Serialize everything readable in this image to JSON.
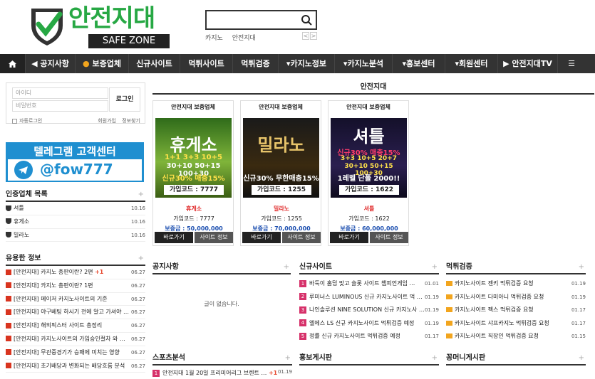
{
  "header": {
    "logo_ko": "안전지대",
    "logo_en": "SAFE ZONE",
    "search_placeholder": "",
    "keywords": [
      "카지노",
      "안전지대"
    ],
    "arrow_prev": "<",
    "arrow_next": ">"
  },
  "nav": [
    {
      "label": "공지사항",
      "icon": "megaphone-icon"
    },
    {
      "label": "보증업체",
      "icon": "medal-icon"
    },
    {
      "label": "신규사이트",
      "icon": ""
    },
    {
      "label": "먹튀사이트",
      "icon": ""
    },
    {
      "label": "먹튀검증",
      "icon": ""
    },
    {
      "label": "카지노정보",
      "icon": "caret-down-icon"
    },
    {
      "label": "카지노분석",
      "icon": "caret-down-icon"
    },
    {
      "label": "홍보센터",
      "icon": "caret-down-icon"
    },
    {
      "label": "회원센터",
      "icon": "caret-down-icon"
    },
    {
      "label": "안전지대TV",
      "icon": "play-icon"
    }
  ],
  "login": {
    "id_placeholder": "아이디",
    "pw_placeholder": "비밀번호",
    "button": "로그인",
    "auto_login": "자동로그인",
    "join": "회원가입",
    "find": "정보찾기"
  },
  "telegram": {
    "title": "텔레그램 고객센터",
    "handle": "@fow777"
  },
  "partners_list": {
    "title": "인증업체 목록",
    "plus": "+",
    "items": [
      {
        "name": "셔틀",
        "date": "10.16"
      },
      {
        "name": "휴게소",
        "date": "10.16"
      },
      {
        "name": "밀라노",
        "date": "10.16"
      }
    ]
  },
  "useful": {
    "title": "유용한 정보",
    "plus": "+",
    "items": [
      {
        "text": "[안전지대] 카지노 총판이란? 2편",
        "count": "+1",
        "date": "06.27"
      },
      {
        "text": "[안전지대] 카지노 총판이란? 1편",
        "count": "",
        "date": "06.27"
      },
      {
        "text": "[안전지대] 메이저 카지노사이트의 기준",
        "count": "",
        "date": "06.27"
      },
      {
        "text": "[안전지대] 야구베팅 하시기 전에 알고 가셔야 …",
        "count": "",
        "date": "06.27"
      },
      {
        "text": "[안전지대] 해외픽스터 사이트 총정리",
        "count": "",
        "date": "06.27"
      },
      {
        "text": "[안전지대] 카지노사이트의 가입승인절차 와 …",
        "count": "",
        "date": "06.27"
      },
      {
        "text": "[안전지대] 무관중경기가 승패에 미치는 영향",
        "count": "",
        "date": "06.27"
      },
      {
        "text": "[안전지대] 초기배당과 변화되는 배당흐름 분석",
        "count": "",
        "date": "06.27"
      }
    ]
  },
  "main": {
    "title": "안전지대",
    "cards": [
      {
        "header": "안전지대 보증업체",
        "banner_title": "휴게소",
        "banner_lines": [
          "1+1 3+3 10+5",
          "30+10 50+15 100+30",
          "신규30% 매충15%"
        ],
        "banner_code": "가입코드 : 7777",
        "name": "휴게소",
        "code": "가입코드 : 7777",
        "guarantee": "보증금 : 50,000,000",
        "btn_go": "바로가기",
        "btn_info": "사이트 정보"
      },
      {
        "header": "안전지대 보증업체",
        "banner_title": "밀라노",
        "banner_lines": [
          "신규30% 무한매충15%"
        ],
        "banner_code": "가입코드 : 1255",
        "name": "밀라노",
        "code": "가입코드 : 1255",
        "guarantee": "보증금 : 70,000,000",
        "btn_go": "바로가기",
        "btn_info": "사이트 정보"
      },
      {
        "header": "안전지대 보증업체",
        "banner_title": "셔틀",
        "banner_lines": [
          "신규30% 매충15%",
          "3+3 10+5 20+7",
          "30+10 50+15 100+30",
          "1레벨 단폴 2000!!"
        ],
        "banner_code": "가입코드 : 1622",
        "name": "셔틀",
        "code": "가입코드 : 1622",
        "guarantee": "보증금 : 60,000,000",
        "btn_go": "바로가기",
        "btn_info": "사이트 정보"
      }
    ]
  },
  "notice": {
    "title": "공지사항",
    "plus": "+",
    "empty": "글이 없습니다."
  },
  "new_sites": {
    "title": "신규사이트",
    "plus": "+",
    "items": [
      {
        "num": "1",
        "text": "바둑이 홈덤 맞고 슬롯 사이트 챔피언게임 …",
        "date": "01.01"
      },
      {
        "num": "2",
        "text": "루미너스 LUMINOUS 신규 카지노사이트 먹 …",
        "date": "01.19"
      },
      {
        "num": "3",
        "text": "나인솔루션 NINE SOLUTION 신규 카지노사 …",
        "date": "01.19"
      },
      {
        "num": "4",
        "text": "엘에스 LS 신규 카지노사이트 먹튀검증 예정",
        "date": "01.19"
      },
      {
        "num": "5",
        "text": "정률 신규 카지노사이트 먹튀검증 예정",
        "date": "01.17"
      }
    ]
  },
  "verify": {
    "title": "먹튀검증",
    "plus": "+",
    "items": [
      {
        "text": "카지노사이트 젠키 먹튀검증 요청",
        "date": "01.19"
      },
      {
        "text": "카지노사이트 다미아니 먹튀검증 요청",
        "date": "01.19"
      },
      {
        "text": "카지노사이트 펙스 먹튀검증 요청",
        "date": "01.17"
      },
      {
        "text": "카지노사이트 샤프카지노 먹튀검증 요청",
        "date": "01.17"
      },
      {
        "text": "카지노사이트 직장인 먹튀검증 요청",
        "date": "01.15"
      }
    ]
  },
  "sports": {
    "title": "스포츠분석",
    "plus": "+",
    "items": [
      {
        "num": "1",
        "text": "안전지대 1월 20일 프리미어리그 브렌트 …",
        "count": "+1",
        "date": "01.19"
      }
    ]
  },
  "promo": {
    "title": "홍보게시판",
    "plus": "+"
  },
  "tips": {
    "title": "꽁머니게시판",
    "plus": "+"
  },
  "colors": {
    "nav_bg": "#333333",
    "brand_green": "#27a844",
    "telegram": "#1f8fd0",
    "accent_red": "#e02a2a",
    "accent_blue": "#1c4fb0"
  }
}
